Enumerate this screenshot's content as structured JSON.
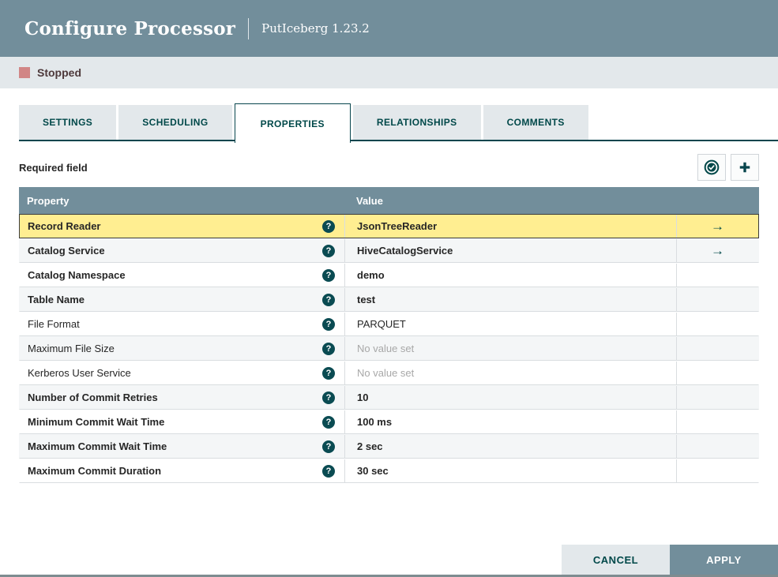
{
  "dialog": {
    "title": "Configure Processor",
    "subtitle": "PutIceberg 1.23.2"
  },
  "status": {
    "label": "Stopped",
    "color": "#d18686"
  },
  "tabs": [
    {
      "label": "SETTINGS",
      "active": false
    },
    {
      "label": "SCHEDULING",
      "active": false
    },
    {
      "label": "PROPERTIES",
      "active": true
    },
    {
      "label": "RELATIONSHIPS",
      "active": false
    },
    {
      "label": "COMMENTS",
      "active": false
    }
  ],
  "toolbar": {
    "required_hint": "Required field",
    "verify_icon": "check-circle-icon",
    "add_icon": "plus-icon"
  },
  "table": {
    "columns": [
      "Property",
      "Value"
    ],
    "rows": [
      {
        "name": "Record Reader",
        "value": "JsonTreeReader",
        "required": true,
        "no_value": false,
        "goto": true,
        "selected": true
      },
      {
        "name": "Catalog Service",
        "value": "HiveCatalogService",
        "required": true,
        "no_value": false,
        "goto": true,
        "selected": false
      },
      {
        "name": "Catalog Namespace",
        "value": "demo",
        "required": true,
        "no_value": false,
        "goto": false,
        "selected": false
      },
      {
        "name": "Table Name",
        "value": "test",
        "required": true,
        "no_value": false,
        "goto": false,
        "selected": false
      },
      {
        "name": "File Format",
        "value": "PARQUET",
        "required": false,
        "no_value": false,
        "goto": false,
        "selected": false
      },
      {
        "name": "Maximum File Size",
        "value": "No value set",
        "required": false,
        "no_value": true,
        "goto": false,
        "selected": false
      },
      {
        "name": "Kerberos User Service",
        "value": "No value set",
        "required": false,
        "no_value": true,
        "goto": false,
        "selected": false
      },
      {
        "name": "Number of Commit Retries",
        "value": "10",
        "required": true,
        "no_value": false,
        "goto": false,
        "selected": false
      },
      {
        "name": "Minimum Commit Wait Time",
        "value": "100 ms",
        "required": true,
        "no_value": false,
        "goto": false,
        "selected": false
      },
      {
        "name": "Maximum Commit Wait Time",
        "value": "2 sec",
        "required": true,
        "no_value": false,
        "goto": false,
        "selected": false
      },
      {
        "name": "Maximum Commit Duration",
        "value": "30 sec",
        "required": true,
        "no_value": false,
        "goto": false,
        "selected": false
      }
    ]
  },
  "footer": {
    "cancel": "CANCEL",
    "apply": "APPLY"
  },
  "colors": {
    "accent_teal": "#004849",
    "header_slate": "#728e9b",
    "selected_row": "#ffee91",
    "status_stopped": "#d18686",
    "bar_gray": "#e3e8eb"
  }
}
